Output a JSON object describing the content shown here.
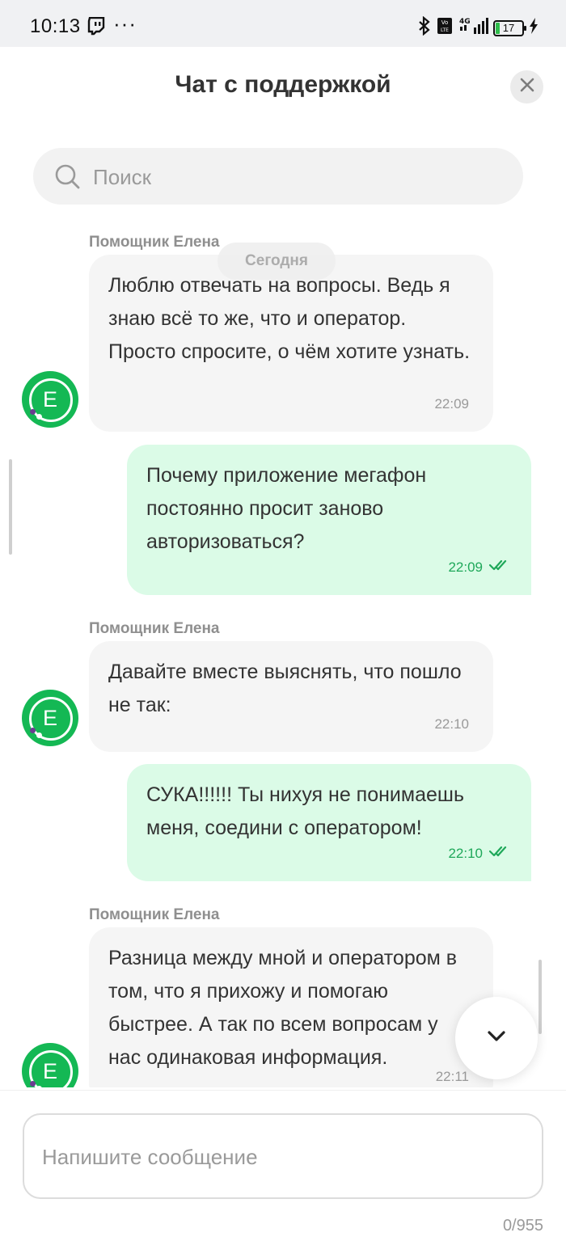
{
  "status_bar": {
    "time": "10:13",
    "dots": "···",
    "network": "4G",
    "volte": "Vo LTE",
    "battery": "17"
  },
  "header": {
    "title": "Чат с поддержкой",
    "close_icon": "close-icon"
  },
  "search": {
    "placeholder": "Поиск",
    "icon": "search-icon"
  },
  "date_separator": "Сегодня",
  "messages": [
    {
      "direction": "incoming",
      "sender": "Помощник Елена",
      "text": "Люблю отвечать на вопросы. Ведь я знаю всё то же, что и оператор. Просто спросите, о чём хотите узнать.",
      "time": "22:09"
    },
    {
      "direction": "outgoing",
      "text": "Почему приложение мегафон постоянно просит заново авторизоваться?",
      "time": "22:09",
      "status": "read"
    },
    {
      "direction": "incoming",
      "sender": "Помощник Елена",
      "text": "Давайте вместе выяснять, что пошло не так:",
      "time": "22:10"
    },
    {
      "direction": "outgoing",
      "text": "СУКА!!!!!! Ты нихуя не понимаешь меня, соедини с оператором!",
      "time": "22:10",
      "status": "read"
    },
    {
      "direction": "incoming",
      "sender": "Помощник Елена",
      "text": "Разница между мной и оператором в том, что я прихожу и помогаю быстрее. А так по всем вопросам у нас одинаковая информация.",
      "time": "22:11"
    }
  ],
  "avatar_letter": "Е",
  "composer": {
    "placeholder": "Напишите сообщение",
    "counter": "0/955"
  },
  "colors": {
    "accent": "#14b854",
    "outgoing_bubble": "#dbfbe7",
    "incoming_bubble": "#f5f5f5",
    "read_ticks": "#1fa85a"
  }
}
